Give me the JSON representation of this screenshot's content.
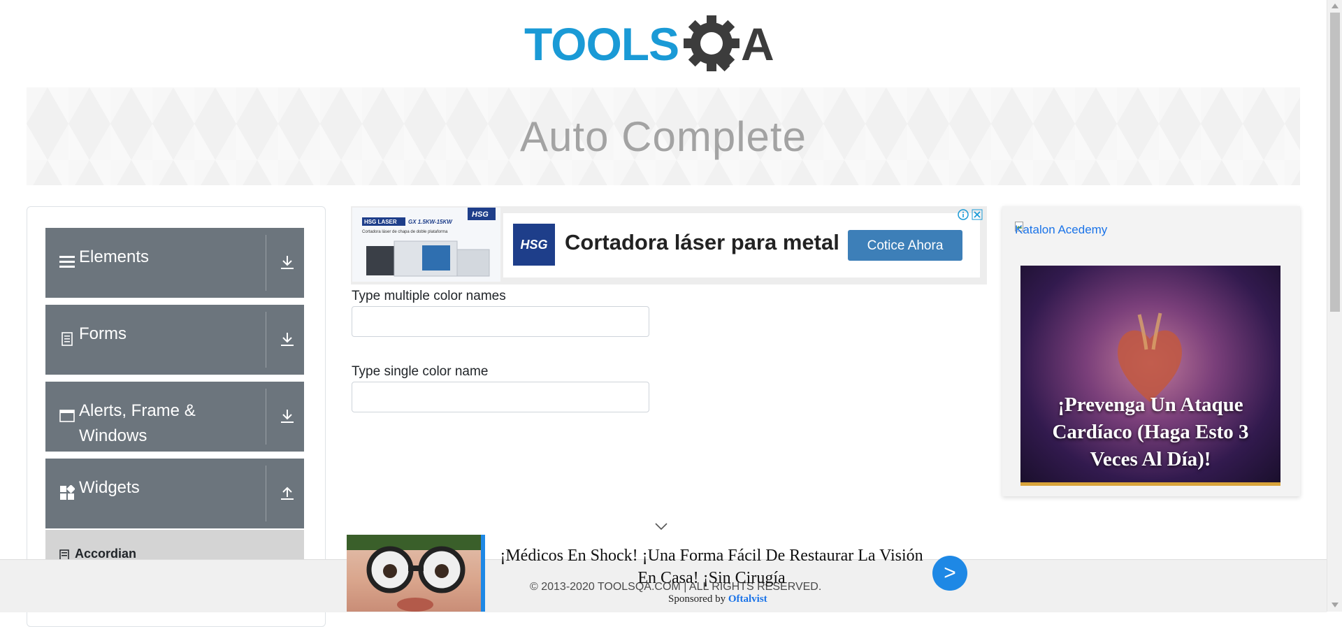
{
  "header": {
    "logo_text_left": "TOOLS",
    "logo_text_right": "A",
    "logo_color_primary": "#1a9ad6",
    "logo_color_secondary": "#3c3c3c"
  },
  "banner": {
    "title": "Auto Complete"
  },
  "sidebar": {
    "groups": [
      {
        "label": "Elements",
        "icon": "hamburger-icon",
        "state": "collapsed"
      },
      {
        "label": "Forms",
        "icon": "document-icon",
        "state": "collapsed"
      },
      {
        "label": "Alerts, Frame & Windows",
        "icon": "window-icon",
        "state": "collapsed"
      },
      {
        "label": "Widgets",
        "icon": "grid-icon",
        "state": "expanded"
      }
    ],
    "sub_items": [
      {
        "label": "Accordian",
        "icon": "accordion-icon"
      }
    ],
    "group_color": "#6c757d"
  },
  "top_ad": {
    "headline": "Cortadora láser para metal",
    "cta": "Cotice Ahora",
    "brand": "HSG",
    "thumb_tag": "HSG LASER",
    "thumb_model": "GX 1.5KW-15KW",
    "thumb_caption": "Cortadora láser de chapa de doble plataforma"
  },
  "form": {
    "multi_label": "Type multiple color names",
    "multi_value": "",
    "single_label": "Type single color name",
    "single_value": ""
  },
  "right_ad": {
    "broken_image_alt": "Katalon Acedemy",
    "caption": "¡Prevenga Un Ataque Cardíaco (Haga Esto 3 Veces Al Día)!"
  },
  "bottom_ad": {
    "text": "¡Médicos En Shock! ¡Una Forma Fácil De Restaurar La Visión En Casa! ¡Sin Cirugía",
    "go": ">",
    "sponsored_prefix": "Sponsored by",
    "sponsor": "Oftalvist"
  },
  "footer": {
    "text": "© 2013-2020 TOOLSQA.COM | ALL RIGHTS RESERVED."
  }
}
